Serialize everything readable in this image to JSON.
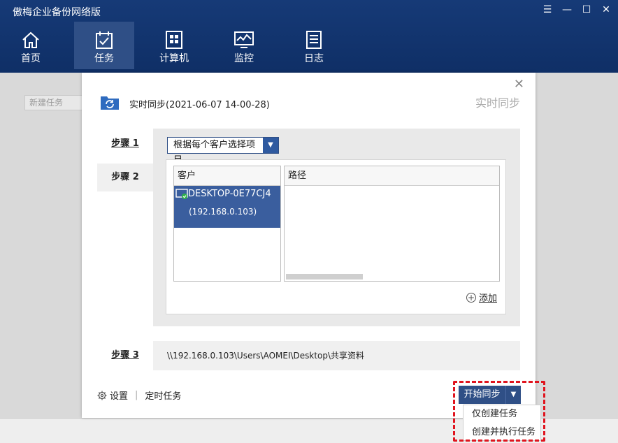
{
  "app": {
    "title": "傲梅企业备份网络版",
    "window_controls": [
      "menu",
      "minimize",
      "maximize",
      "close"
    ]
  },
  "nav": [
    {
      "label": "首页",
      "icon": "home-icon"
    },
    {
      "label": "任务",
      "icon": "task-icon",
      "active": true
    },
    {
      "label": "计算机",
      "icon": "computer-icon"
    },
    {
      "label": "监控",
      "icon": "monitor-icon"
    },
    {
      "label": "日志",
      "icon": "log-icon"
    }
  ],
  "background": {
    "new_task_label": "新建任务"
  },
  "dialog": {
    "title": "实时同步(2021-06-07 14-00-28)",
    "subtitle": "实时同步",
    "steps": [
      {
        "label": "步骤 1"
      },
      {
        "label": "步骤 2"
      },
      {
        "label": "步骤 3"
      }
    ],
    "dropdown_value": "根据每个客户选择项目",
    "columns": {
      "client": "客户",
      "path": "路径"
    },
    "clients": [
      {
        "name": "DESKTOP-0E77CJ4",
        "ip": "(192.168.0.103)",
        "selected": true
      }
    ],
    "add_label": "添加",
    "step3_path": "\\\\192.168.0.103\\Users\\AOMEI\\Desktop\\共享资料",
    "settings_label": "设置",
    "schedule_label": "定时任务",
    "start_button": "开始同步",
    "menu_items": [
      "仅创建任务",
      "创建并执行任务"
    ]
  },
  "colors": {
    "header_bg": "#163a77",
    "active_nav": "#2f4f86",
    "selection": "#3a5e9e",
    "highlight_border": "#e0141e"
  }
}
